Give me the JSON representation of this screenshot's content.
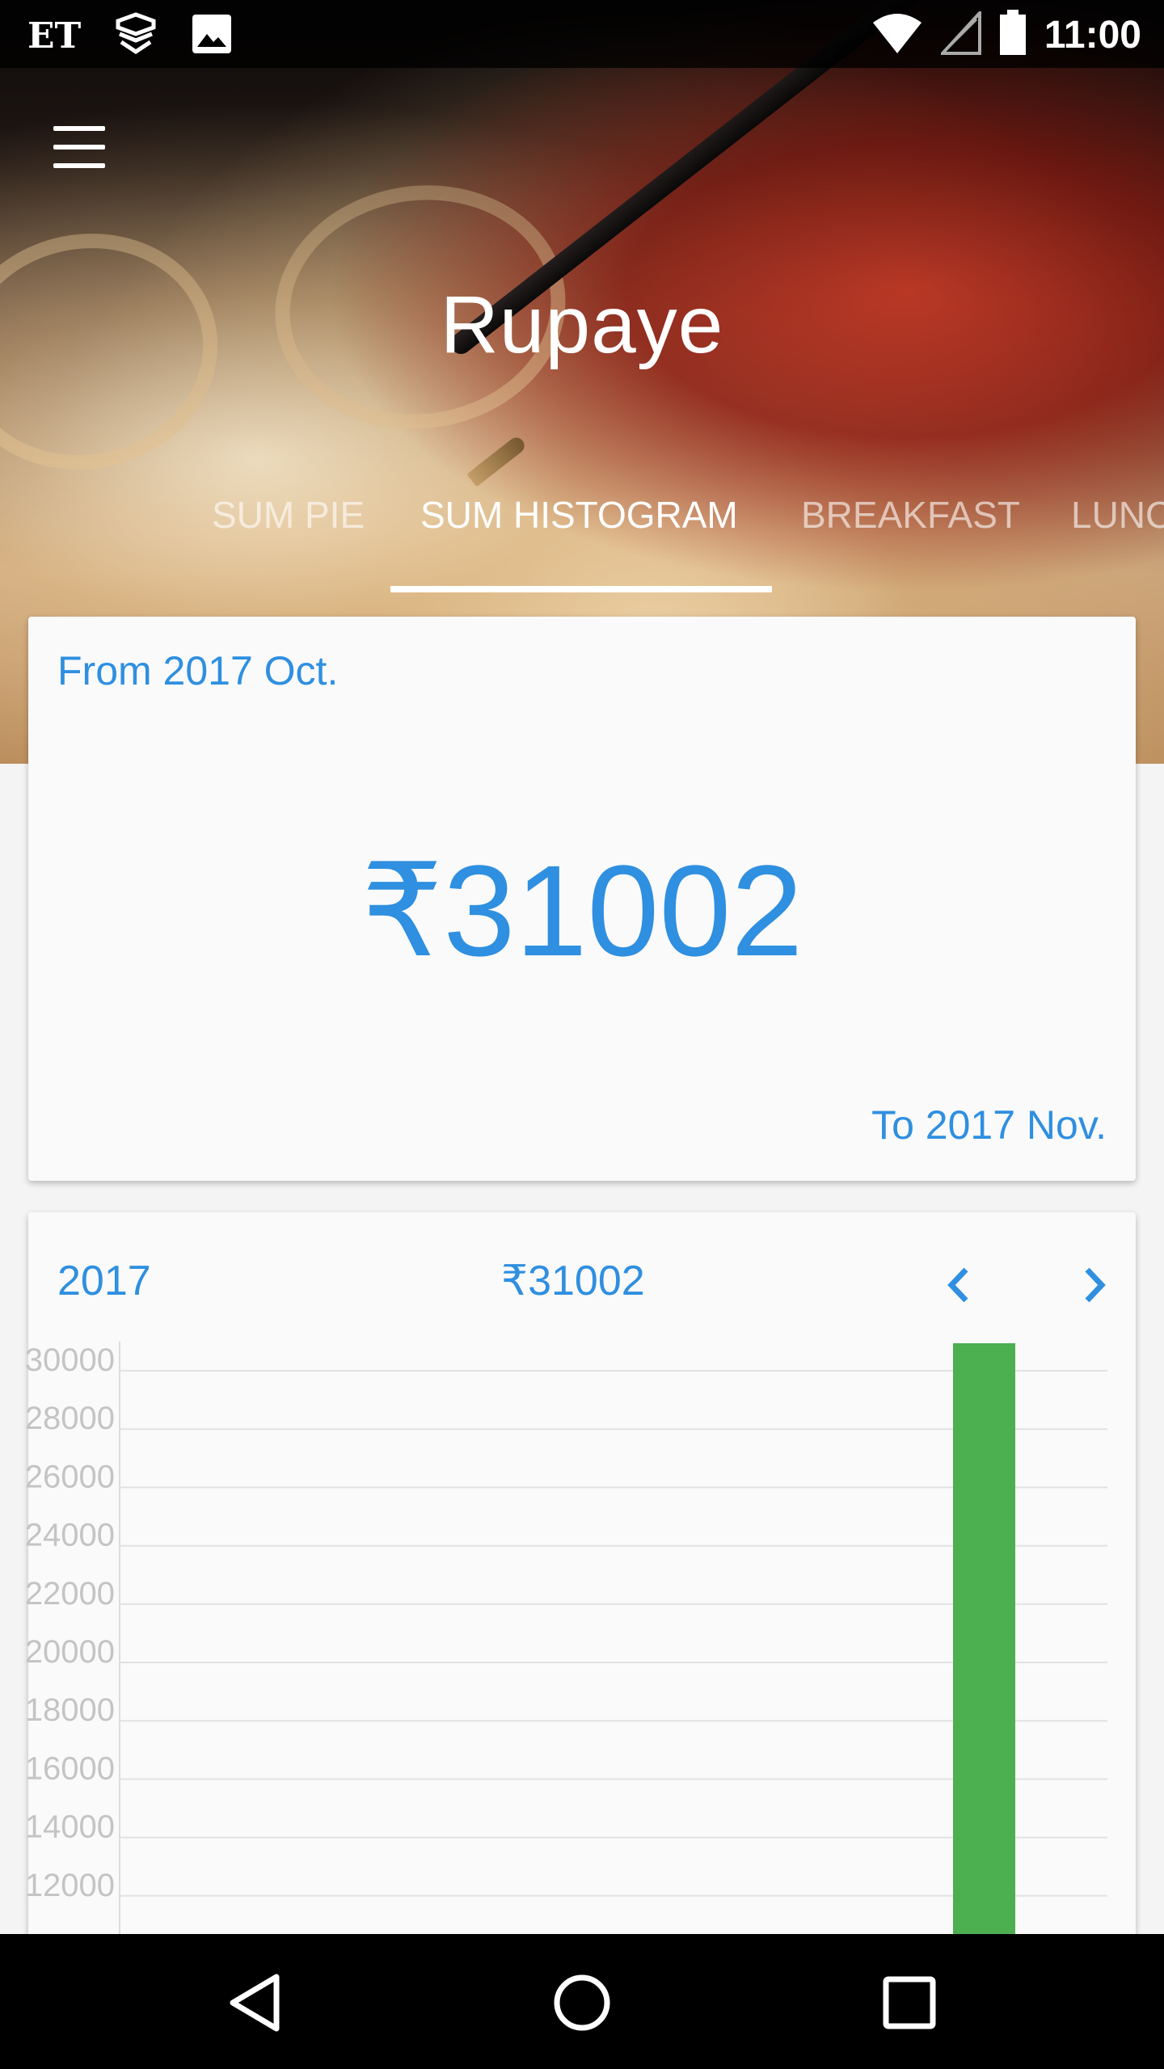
{
  "status_bar": {
    "carrier_label": "ET",
    "time": "11:00",
    "icons": [
      "et-logo",
      "shield-app-icon",
      "image-icon",
      "wifi-icon",
      "signal-icon",
      "battery-icon"
    ]
  },
  "app": {
    "title": "Rupaye",
    "menu_icon": "hamburger-menu-icon"
  },
  "tabs": [
    {
      "label": "SUM PIE",
      "active": false
    },
    {
      "label": "SUM HISTOGRAM",
      "active": true
    },
    {
      "label": "BREAKFAST",
      "active": false
    },
    {
      "label": "LUNC",
      "active": false
    }
  ],
  "summary_card": {
    "from_label": "From 2017 Oct.",
    "amount": "₹31002",
    "to_label": "To 2017 Nov."
  },
  "histogram_card": {
    "year": "2017",
    "sum": "₹31002",
    "prev_icon": "chevron-left-icon",
    "next_icon": "chevron-right-icon"
  },
  "chart_data": {
    "type": "bar",
    "y_tick_labels": [
      "30000",
      "28000",
      "26000",
      "24000",
      "22000",
      "20000",
      "18000",
      "16000",
      "14000",
      "12000"
    ],
    "ylim_visible": [
      11800,
      30000
    ],
    "bars": [
      {
        "value": 31002,
        "color": "#4caf50"
      }
    ],
    "grid": true
  },
  "colors": {
    "accent": "#2f8fe0",
    "bar": "#4caf50",
    "card_bg": "#fafafa"
  },
  "nav_bar": {
    "icons": [
      "back-triangle-icon",
      "home-circle-icon",
      "recents-square-icon"
    ]
  }
}
